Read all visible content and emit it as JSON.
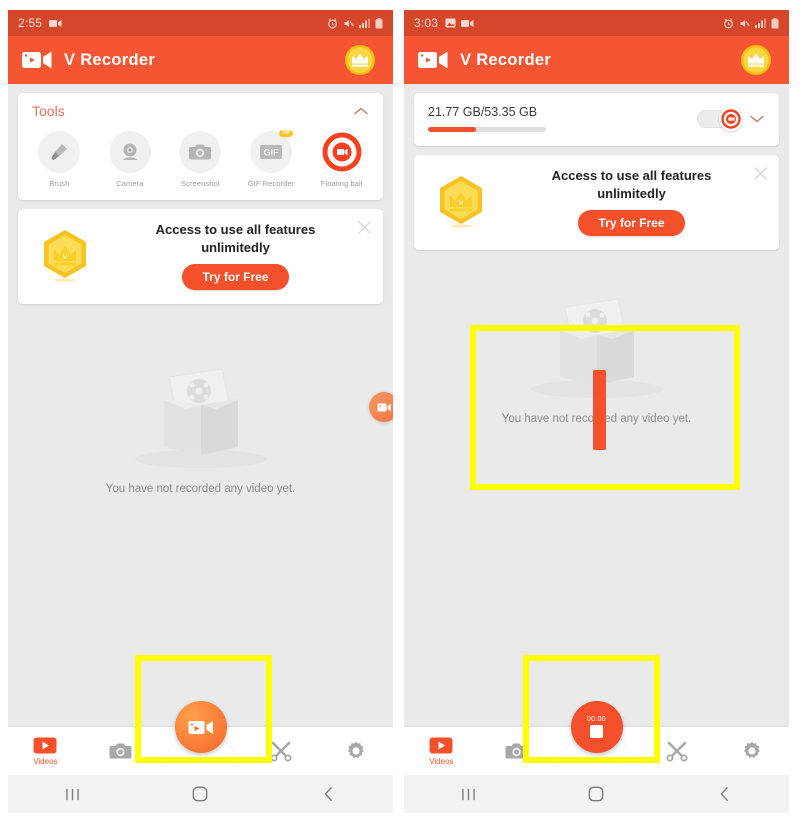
{
  "app": {
    "name": "V Recorder",
    "accent": "#f55532",
    "status_bar_bg": "#d6462a",
    "background": "#eaeaea",
    "highlight_color": "#ffff00"
  },
  "left_phone": {
    "status_bar": {
      "time": "2:55",
      "left_icons": [
        "video-recorder-icon"
      ],
      "right_icons": [
        "alarm-icon",
        "mute-icon",
        "signal-icon",
        "battery-icon"
      ]
    },
    "appbar": {
      "title": "V Recorder",
      "logo": "video-camera-icon",
      "vip_badge": "crown-icon"
    },
    "tools_card": {
      "title": "Tools",
      "chevron": "chevron-up-icon",
      "items": [
        {
          "label": "Brush",
          "icon": "brush-icon",
          "badge": ""
        },
        {
          "label": "Camera",
          "icon": "webcam-icon",
          "badge": ""
        },
        {
          "label": "Screenshot",
          "icon": "camera-icon",
          "badge": ""
        },
        {
          "label": "GIF Recorder",
          "icon": "gif-icon",
          "badge": "VIP"
        },
        {
          "label": "Floating ball",
          "icon": "record-ring-icon",
          "badge": ""
        }
      ]
    },
    "promo": {
      "title": "Access to use all features unlimitedly",
      "button": "Try for Free",
      "close": "close-icon",
      "crown": "crown-hexagon-icon"
    },
    "empty_state": {
      "text": "You have not recorded any video yet.",
      "illustration": "empty-box-icon"
    },
    "floating_ball": {
      "icon": "video-camera-icon"
    },
    "bottom_nav": {
      "items": [
        {
          "label": "Videos",
          "icon": "videos-icon",
          "active": true
        },
        {
          "label": "",
          "icon": "camera-icon",
          "active": false
        },
        {
          "label": "",
          "icon": "tools-scissors-icon",
          "active": false
        },
        {
          "label": "",
          "icon": "gear-icon",
          "active": false
        }
      ],
      "fab": {
        "icon": "video-camera-icon",
        "state": "idle",
        "timer": ""
      }
    },
    "android_nav": [
      "recents-icon",
      "home-icon",
      "back-icon"
    ]
  },
  "right_phone": {
    "status_bar": {
      "time": "3:03",
      "left_icons": [
        "image-icon",
        "video-recorder-icon"
      ],
      "right_icons": [
        "alarm-icon",
        "mute-icon",
        "signal-icon",
        "battery-icon"
      ]
    },
    "appbar": {
      "title": "V Recorder",
      "logo": "video-camera-icon",
      "vip_badge": "crown-icon"
    },
    "storage_card": {
      "text": "21.77 GB/53.35 GB",
      "used_gb": 21.77,
      "total_gb": 53.35,
      "fill_percent": 41,
      "toggle": "record-toggle-icon",
      "chevron": "chevron-down-icon"
    },
    "promo": {
      "title": "Access to use all features unlimitedly",
      "button": "Try for Free",
      "close": "close-icon",
      "crown": "crown-hexagon-icon"
    },
    "empty_state": {
      "text": "You have not recorded any video yet.",
      "illustration": "empty-box-icon"
    },
    "bottom_nav": {
      "items": [
        {
          "label": "Videos",
          "icon": "videos-icon",
          "active": true
        },
        {
          "label": "",
          "icon": "camera-icon",
          "active": false
        },
        {
          "label": "",
          "icon": "tools-scissors-icon",
          "active": false
        },
        {
          "label": "",
          "icon": "gear-icon",
          "active": false
        }
      ],
      "fab": {
        "icon": "stop-icon",
        "state": "recording",
        "timer": "00:00"
      }
    },
    "android_nav": [
      "recents-icon",
      "home-icon",
      "back-icon"
    ]
  }
}
